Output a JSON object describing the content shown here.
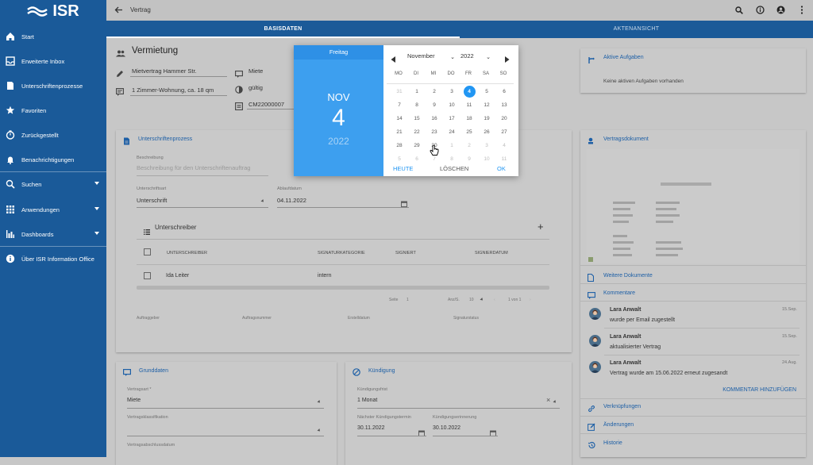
{
  "app": {
    "logo": "ISR"
  },
  "sidebar": {
    "items": [
      {
        "label": "Start",
        "icon": "home-icon"
      },
      {
        "label": "Erweiterte Inbox",
        "icon": "inbox-icon"
      },
      {
        "label": "Unterschriftenprozesse",
        "icon": "document-icon"
      },
      {
        "label": "Favoriten",
        "icon": "star-icon"
      },
      {
        "label": "Zurückgestellt",
        "icon": "timer-icon"
      },
      {
        "label": "Benachrichtigungen",
        "icon": "bell-icon"
      },
      {
        "label": "Suchen",
        "icon": "search-icon"
      },
      {
        "label": "Anwendungen",
        "icon": "apps-icon"
      },
      {
        "label": "Dashboards",
        "icon": "chart-icon"
      },
      {
        "label": "Über ISR Information Office",
        "icon": "info-icon"
      }
    ]
  },
  "topbar": {
    "title": "Vertrag"
  },
  "tabs": [
    "BASISDATEN",
    "AKTENANSICHT"
  ],
  "header": {
    "title": "Vermietung",
    "name": "Mietvertrag Hammer Str.",
    "desc": "1 Zimmer-Wohnung, ca. 18 qm",
    "type": "Miete",
    "status": "gültig",
    "number": "CM22000007"
  },
  "sig": {
    "title": "Unterschriftenprozess",
    "desc_label": "Beschreibung",
    "desc_placeholder": "Beschreibung für den Unterschriftenauftrag",
    "type_label": "Unterschriftsart",
    "type_value": "Unterschrift",
    "date_label": "Ablaufdatum",
    "date_value": "04.11.2022",
    "signers_title": "Unterschreiber",
    "cols": [
      "UNTERSCHREIBER",
      "SIGNATURKATEGORIE",
      "SIGNIERT",
      "SIGNIERDATUM"
    ],
    "row": {
      "name": "Ida Leiter",
      "category": "intern"
    },
    "page_label": "Seite",
    "page_value": "1",
    "per_page_label": "Anz/S.",
    "per_page_value": "10",
    "range": "1 von 1",
    "footer": [
      "Auftraggeber",
      "Auftragsnummer",
      "Erstelldatum",
      "Signaturstatus"
    ]
  },
  "grund": {
    "title": "Grunddaten",
    "art_label": "Vertragsart *",
    "art_value": "Miete",
    "class_label": "Vertragsklassifikation",
    "start_label": "Vertragsabschlussdatum"
  },
  "kuend": {
    "title": "Kündigung",
    "frist_label": "Kündigungsfrist",
    "frist_value": "1 Monat",
    "next_label": "Nächster Kündigungstermin",
    "next_value": "30.11.2022",
    "remind_label": "Kündigungserinnerung",
    "remind_value": "30.10.2022"
  },
  "right": {
    "tasks_title": "Aktive Aufgaben",
    "tasks_empty": "Keine aktiven Aufgaben vorhanden",
    "doc_title": "Vertragsdokument",
    "more_docs": "Weitere Dokumente",
    "comments_title": "Kommentare",
    "comments": [
      {
        "author": "Lara Anwalt",
        "date": "15.Sep.",
        "text": "wurde per Email zugestellt"
      },
      {
        "author": "Lara Anwalt",
        "date": "15.Sep.",
        "text": "aktualisierter Vertrag"
      },
      {
        "author": "Lara Anwalt",
        "date": "24.Aug.",
        "text": "Vertrag wurde am 15.06.2022 erneut zugesandt"
      }
    ],
    "add_comment": "KOMMENTAR HINZUFÜGEN",
    "links": "Verknüpfungen",
    "changes": "Änderungen",
    "history": "Historie"
  },
  "picker": {
    "weekday": "Freitag",
    "month_short": "NOV",
    "day": "4",
    "year": "2022",
    "month_select": "November",
    "year_select": "2022",
    "weekdays": [
      "MO",
      "DI",
      "MI",
      "DO",
      "FR",
      "SA",
      "SO"
    ],
    "weeks": [
      [
        "31",
        "1",
        "2",
        "3",
        "4",
        "5",
        "6"
      ],
      [
        "7",
        "8",
        "9",
        "10",
        "11",
        "12",
        "13"
      ],
      [
        "14",
        "15",
        "16",
        "17",
        "18",
        "19",
        "20"
      ],
      [
        "21",
        "22",
        "23",
        "24",
        "25",
        "26",
        "27"
      ],
      [
        "28",
        "29",
        "30",
        "1",
        "2",
        "3",
        "4"
      ],
      [
        "5",
        "6",
        "7",
        "8",
        "9",
        "10",
        "11"
      ]
    ],
    "today": "HEUTE",
    "clear": "LÖSCHEN",
    "ok": "OK"
  }
}
